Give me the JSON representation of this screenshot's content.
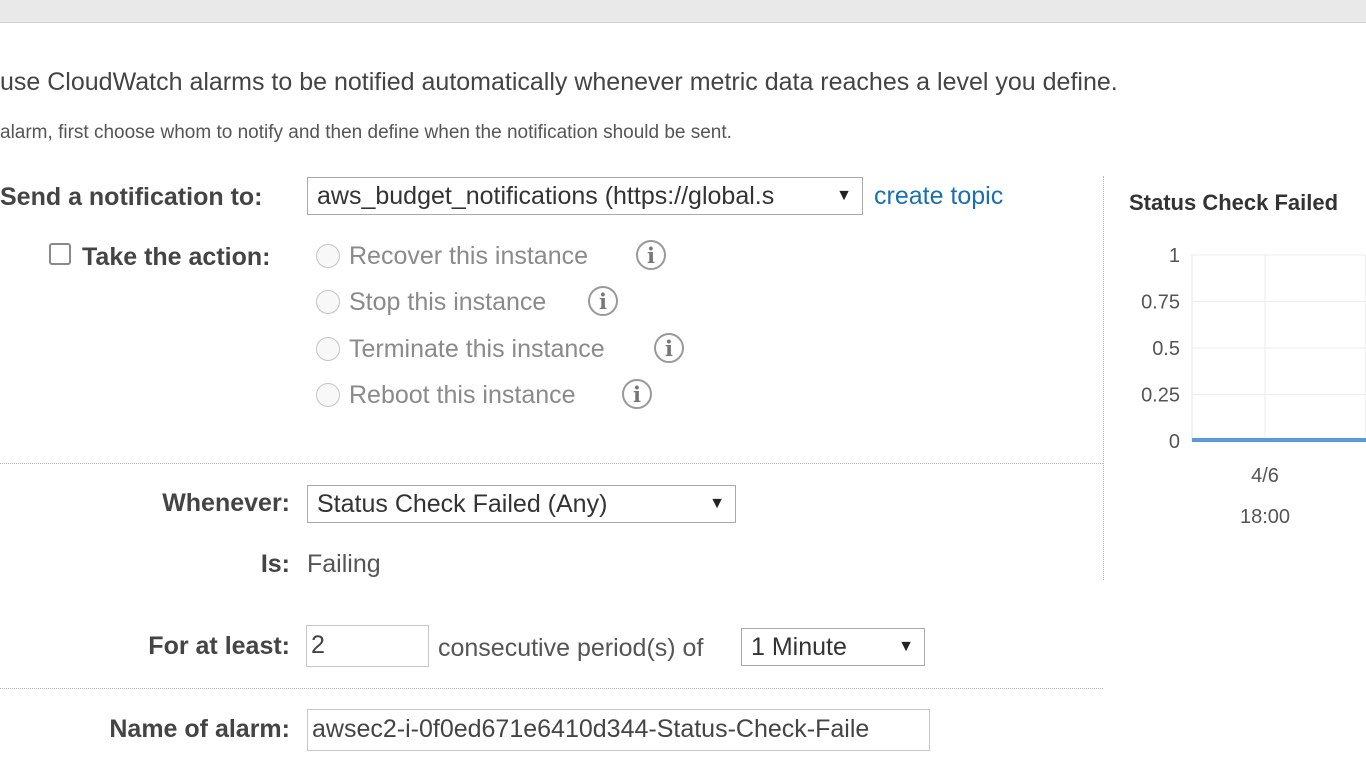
{
  "intro": {
    "headline": "use CloudWatch alarms to be notified automatically whenever metric data reaches a level you define.",
    "subline": "alarm, first choose whom to notify and then define when the notification should be sent."
  },
  "notification": {
    "label": "Send a notification to:",
    "selected": "aws_budget_notifications (https://global.s",
    "create_link": "create topic"
  },
  "action": {
    "label": "Take the action:",
    "checked": false,
    "options": [
      {
        "label": "Recover this instance"
      },
      {
        "label": "Stop this instance"
      },
      {
        "label": "Terminate this instance"
      },
      {
        "label": "Reboot this instance"
      }
    ]
  },
  "whenever": {
    "label": "Whenever:",
    "selected": "Status Check Failed (Any)"
  },
  "is": {
    "label": "Is:",
    "value": "Failing"
  },
  "for_at_least": {
    "label": "For at least:",
    "periods": "2",
    "middle_text": "consecutive period(s) of",
    "period_selected": "1 Minute"
  },
  "alarm_name": {
    "label": "Name of alarm:",
    "value": "awsec2-i-0f0ed671e6410d344-Status-Check-Faile"
  },
  "icons": {
    "dropdown": "caret-down-icon",
    "info": "info-icon"
  },
  "colors": {
    "link": "#1a6fb0",
    "series": "#5b9bd5"
  },
  "chart_data": {
    "type": "line",
    "title": "Status Check Failed",
    "yticks": [
      "1",
      "0.75",
      "0.5",
      "0.25",
      "0"
    ],
    "ylim": [
      0,
      1
    ],
    "x_tick_label": [
      "4/6",
      "18:00"
    ],
    "series": [
      {
        "values": [
          0,
          0
        ]
      }
    ],
    "grid": true
  }
}
